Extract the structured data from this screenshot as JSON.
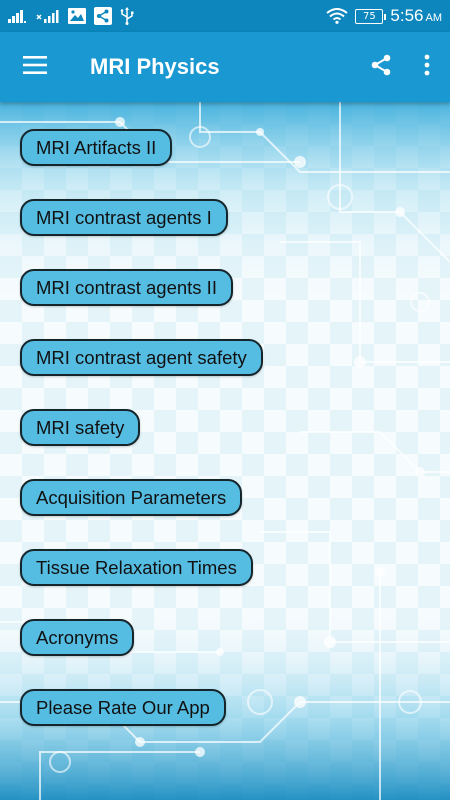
{
  "status_bar": {
    "signal_icon": "signal-bars-icon",
    "signal2_icon": "signal-no-sim-icon",
    "gallery_icon": "image-icon",
    "share_icon": "share-icon",
    "usb_icon": "usb-icon",
    "wifi_icon": "wifi-icon",
    "battery_level": "75",
    "time": "5:56",
    "ampm": "AM"
  },
  "app_bar": {
    "title": "MRI Physics",
    "menu_icon": "hamburger-menu-icon",
    "share_icon": "share-icon",
    "overflow_icon": "more-vert-icon"
  },
  "menu": {
    "items": [
      {
        "label": "MRI Artifacts II"
      },
      {
        "label": "MRI contrast agents I"
      },
      {
        "label": "MRI contrast agents II"
      },
      {
        "label": "MRI contrast agent safety"
      },
      {
        "label": "MRI safety"
      },
      {
        "label": "Acquisition Parameters"
      },
      {
        "label": "Tissue Relaxation Times"
      },
      {
        "label": "Acronyms"
      },
      {
        "label": "Please Rate Our App"
      }
    ]
  },
  "colors": {
    "status_bar": "#0c86bd",
    "app_bar": "#1a98d1",
    "button_fill": "#56bde2",
    "button_border": "#14252b"
  }
}
